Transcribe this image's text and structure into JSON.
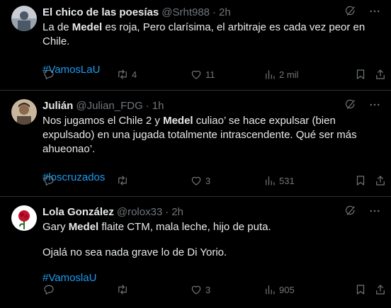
{
  "tweets": [
    {
      "name": "El chico de las poesías",
      "handle": "@Srht988",
      "time": "2h",
      "body": [
        {
          "before": "La de ",
          "bold": "Medel",
          "after": " es roja, Pero clarísima, el arbitraje es cada vez peor en Chile."
        }
      ],
      "hashtag": "#VamosLaU",
      "stats": {
        "replies": "",
        "retweets": "4",
        "likes": "11",
        "views": "2 mil"
      },
      "avatar_colors": {
        "bg": "#c9ccd3",
        "accent": "#4a5868"
      }
    },
    {
      "name": "Julián",
      "handle": "@Julian_FDG",
      "time": "1h",
      "body": [
        {
          "before": "Nos jugamos el Chile 2 y ",
          "bold": "Medel",
          "after": " culiao’ se hace expulsar (bien expulsado) en una jugada totalmente intrascendente. Qué ser más ahueonao’."
        }
      ],
      "hashtag": "#loscruzados",
      "stats": {
        "replies": "",
        "retweets": "",
        "likes": "3",
        "views": "531"
      },
      "avatar_colors": {
        "bg": "#c8b79e",
        "accent": "#3a2a1f"
      }
    },
    {
      "name": "Lola González",
      "handle": "@rolox33",
      "time": "2h",
      "body": [
        {
          "before": "Gary ",
          "bold": "Medel",
          "after": " flaite CTM, mala leche, hijo de puta."
        },
        {
          "before": "Ojalá no sea nada grave lo de Di Yorio.",
          "bold": "",
          "after": ""
        }
      ],
      "hashtag": "#VamoslaU",
      "stats": {
        "replies": "",
        "retweets": "",
        "likes": "3",
        "views": "905"
      },
      "avatar_colors": {
        "bg": "#ffffff",
        "accent": "#c8102e"
      }
    }
  ],
  "icons": {
    "reply": "reply-icon",
    "retweet": "retweet-icon",
    "like": "heart-icon",
    "views": "views-icon",
    "bookmark": "bookmark-icon",
    "share": "share-icon",
    "grok": "grok-icon",
    "more": "more-icon"
  },
  "colors": {
    "background": "#000000",
    "text": "#e7e9ea",
    "muted": "#71767b",
    "link": "#1d9bf0",
    "divider": "#2f3336"
  }
}
